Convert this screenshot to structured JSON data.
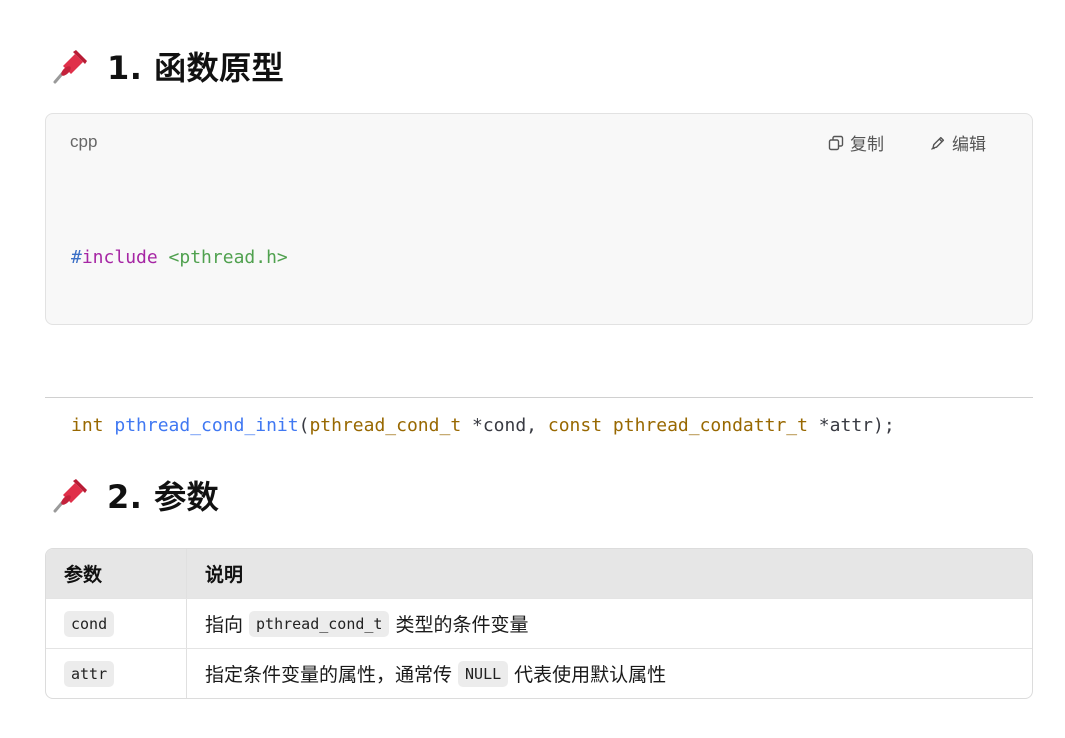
{
  "section1": {
    "title": "1. 函数原型",
    "icon": "pushpin-icon"
  },
  "code_block": {
    "language": "cpp",
    "copy_label": "复制",
    "edit_label": "编辑",
    "lines": {
      "l1": {
        "hash": "#",
        "kw": "include",
        "sp": " ",
        "header": "<pthread.h>"
      },
      "l2": {
        "ret": "int",
        "sp1": " ",
        "fn": "pthread_cond_init",
        "open": "(",
        "t1": "pthread_cond_t",
        "a1": " *cond, ",
        "kw": "const",
        "sp2": " ",
        "t2": "pthread_condattr_t",
        "a2": " *attr);"
      }
    }
  },
  "section2": {
    "title": "2. 参数",
    "icon": "pushpin-icon"
  },
  "param_table": {
    "headers": [
      "参数",
      "说明"
    ],
    "rows": [
      {
        "param": "cond",
        "desc_pre": "指向",
        "desc_code": "pthread_cond_t",
        "desc_post": "类型的条件变量"
      },
      {
        "param": "attr",
        "desc_pre": "指定条件变量的属性，通常传",
        "desc_code": "NULL",
        "desc_post": "代表使用默认属性"
      }
    ]
  }
}
